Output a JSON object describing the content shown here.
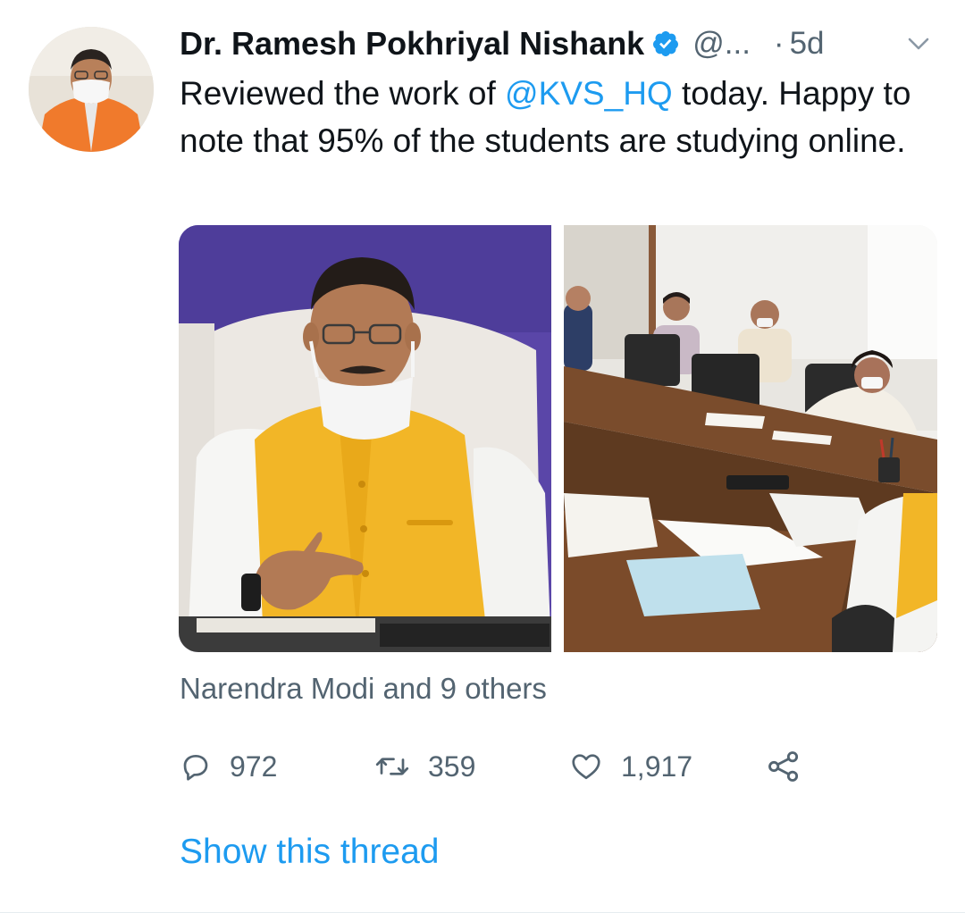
{
  "tweet": {
    "author": {
      "display_name": "Dr. Ramesh Pokhriyal Nishank",
      "handle": "@...",
      "verified": true,
      "avatar_icon": "profile-photo"
    },
    "separator": "·",
    "time": "5d",
    "text": {
      "before_mention": "Reviewed the work of ",
      "mention": "@KVS_HQ",
      "after_mention": " today. Happy to note that 95% of the students are studying online."
    },
    "media": [
      {
        "icon": "photo",
        "subject": "minister-at-desk"
      },
      {
        "icon": "photo",
        "subject": "conference-room-meeting"
      }
    ],
    "social_context": "Narendra Modi and 9 others",
    "actions": {
      "reply_count": "972",
      "retweet_count": "359",
      "like_count": "1,917"
    },
    "show_thread_label": "Show this thread"
  },
  "colors": {
    "accent": "#1d9bf0",
    "secondary_text": "#536471",
    "primary_text": "#0f1419"
  }
}
